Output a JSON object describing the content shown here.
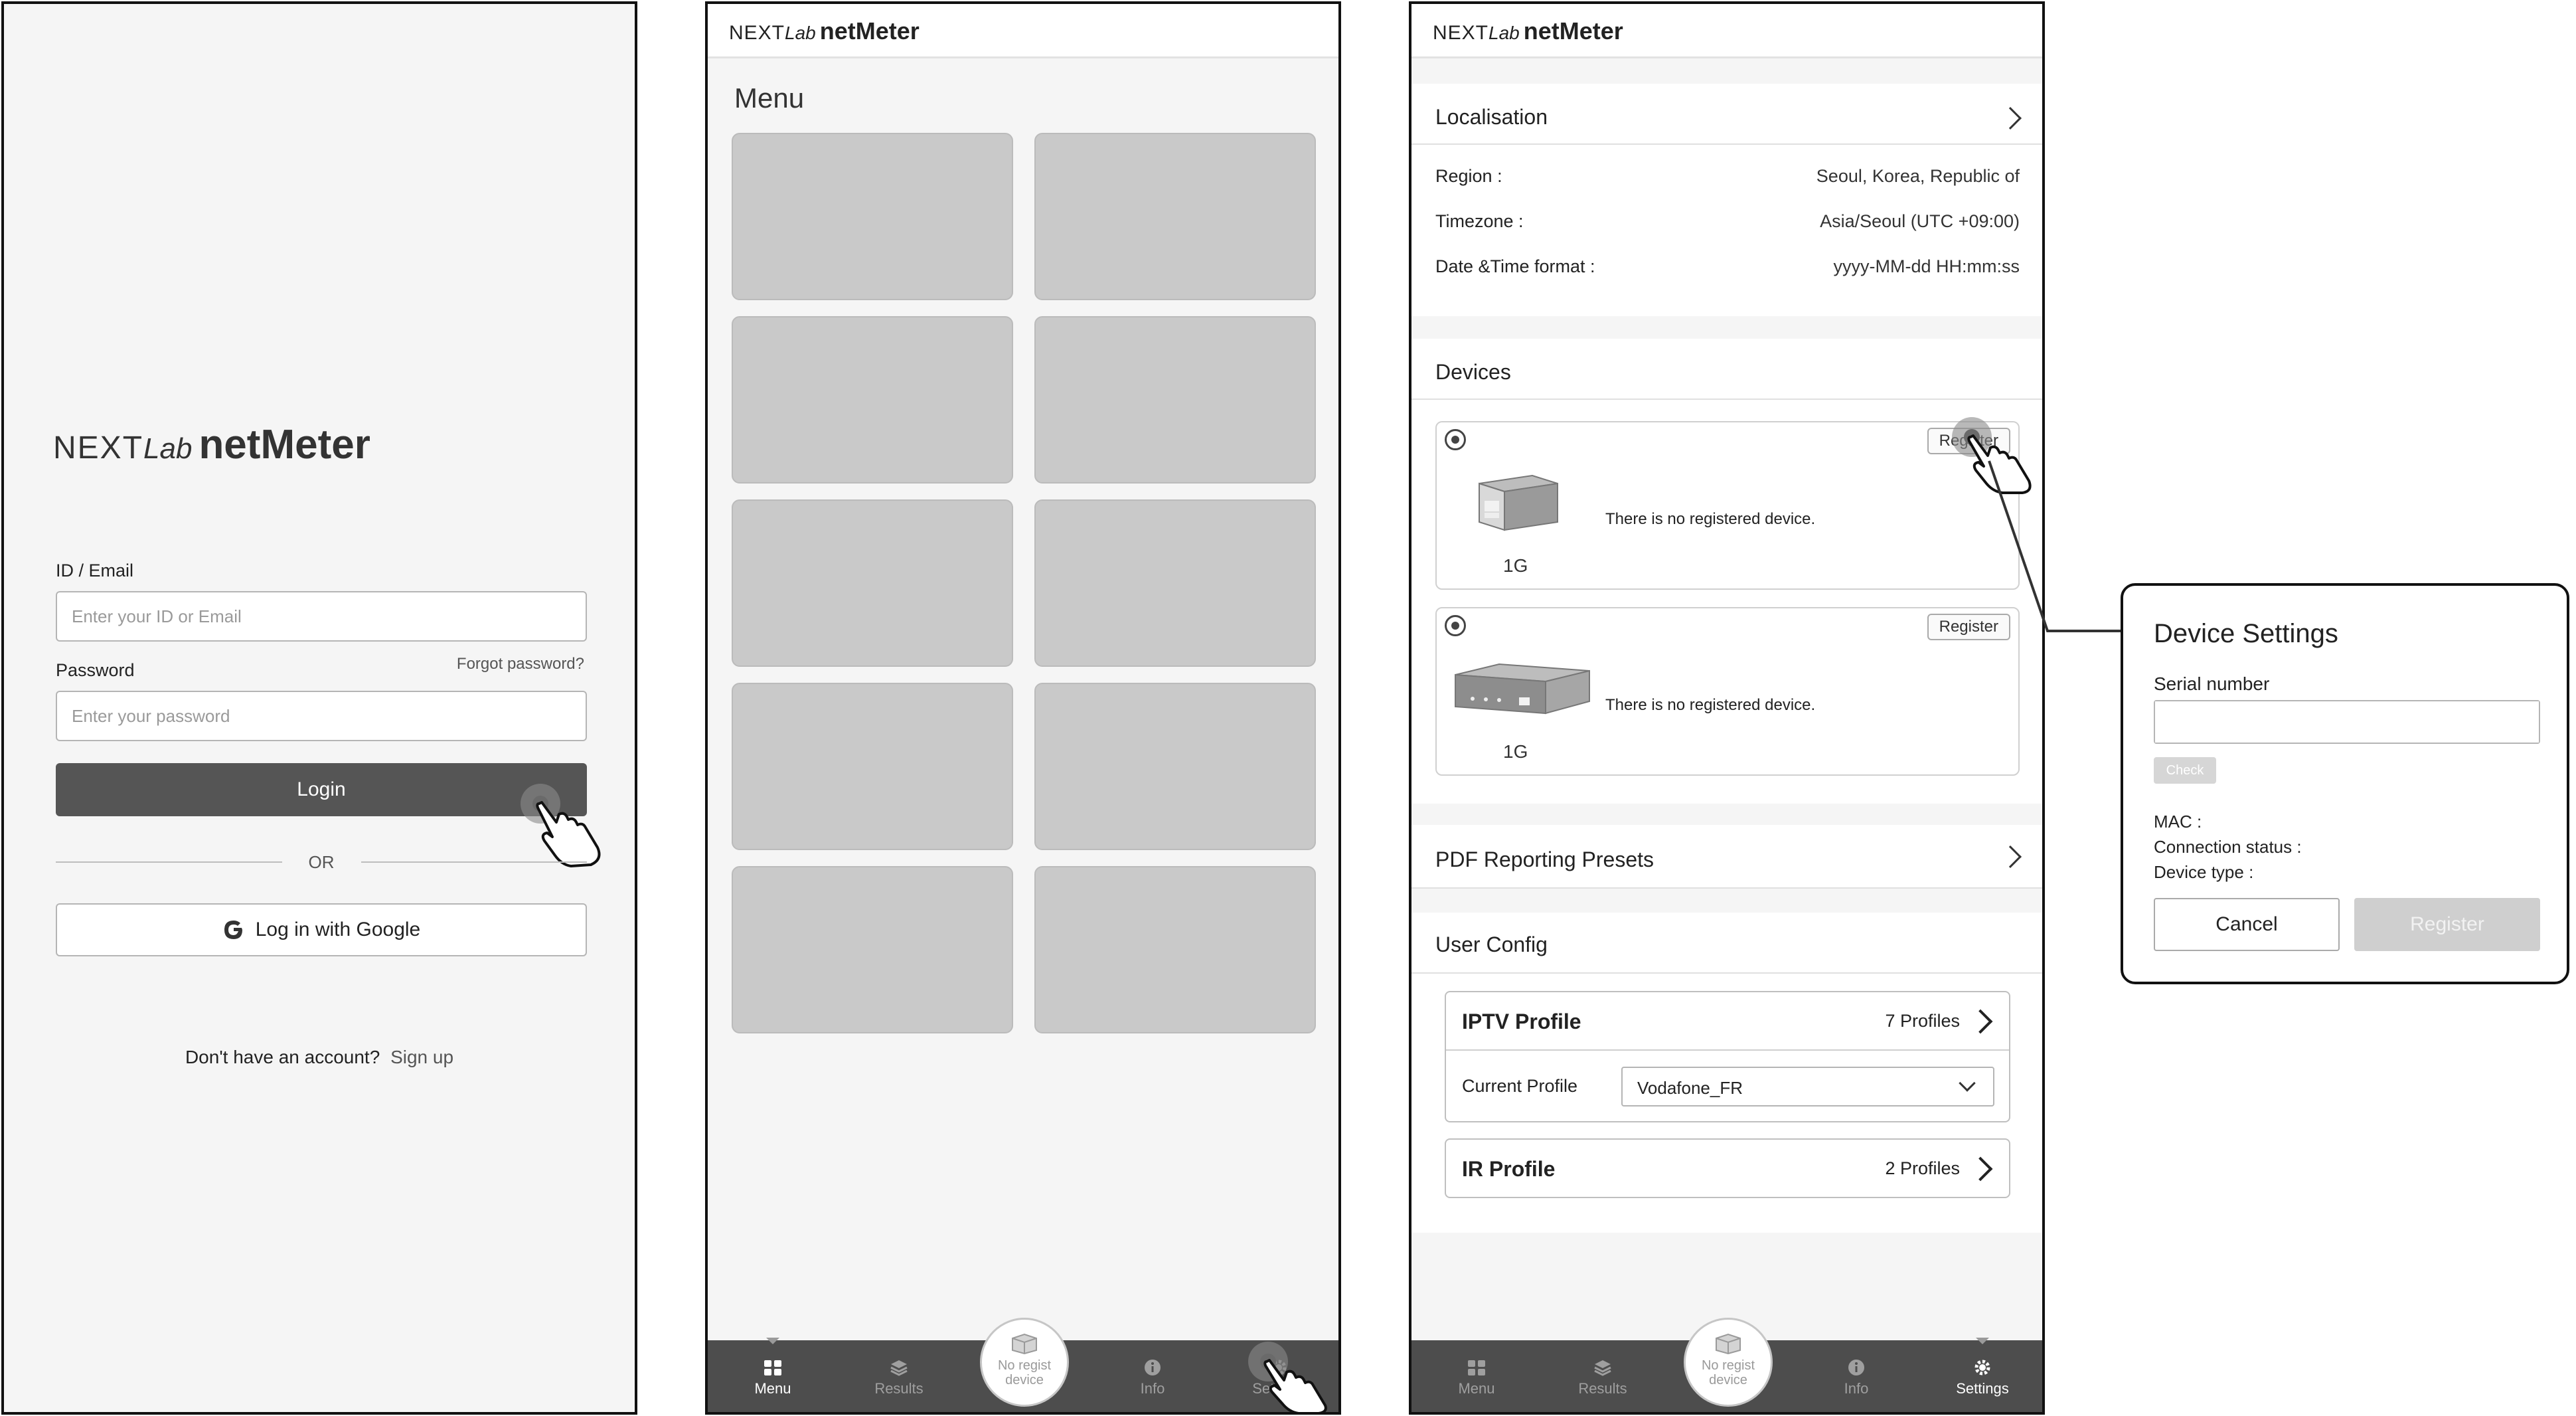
{
  "login": {
    "brand": {
      "next": "NEXT",
      "lab": "Lab",
      "product": "netMeter"
    },
    "id_label": "ID / Email",
    "id_placeholder": "Enter your ID or Email",
    "password_label": "Password",
    "forgot_label": "Forgot password?",
    "password_placeholder": "Enter your password",
    "login_button": "Login",
    "or_label": "OR",
    "google_button": "Log in with Google",
    "no_account_text": "Don't have an account?",
    "signup_link": "Sign up"
  },
  "menu": {
    "brand": {
      "next": "NEXT",
      "lab": "Lab",
      "product": "netMeter"
    },
    "heading": "Menu",
    "tiles": [
      "",
      "",
      "",
      "",
      "",
      "",
      "",
      "",
      "",
      ""
    ]
  },
  "nav": {
    "menu": "Menu",
    "results": "Results",
    "center_line1": "No regist",
    "center_line2": "device",
    "info": "Info",
    "settings": "Settings"
  },
  "settings": {
    "brand": {
      "next": "NEXT",
      "lab": "Lab",
      "product": "netMeter"
    },
    "localisation": {
      "title": "Localisation",
      "region_label": "Region :",
      "region_value": "Seoul, Korea, Republic of",
      "timezone_label": "Timezone :",
      "timezone_value": "Asia/Seoul (UTC +09:00)",
      "datetime_label": "Date &Time format :",
      "datetime_value": "yyyy-MM-dd HH:mm:ss"
    },
    "devices": {
      "title": "Devices",
      "cards": [
        {
          "register_label": "Register",
          "message": "There is no registered device.",
          "speed": "1G"
        },
        {
          "register_label": "Register",
          "message": "There is no registered device.",
          "speed": "1G"
        }
      ]
    },
    "pdf_presets": "PDF Reporting Presets",
    "user_config": {
      "title": "User Config",
      "iptv": {
        "title": "IPTV Profile",
        "count": "7 Profiles",
        "current_label": "Current Profile",
        "current_value": "Vodafone_FR"
      },
      "ir": {
        "title": "IR Profile",
        "count": "2 Profiles"
      }
    }
  },
  "dialog": {
    "title": "Device Settings",
    "serial_label": "Serial number",
    "serial_value": "",
    "check_button": "Check",
    "mac_label": "MAC :",
    "connection_label": "Connection status :",
    "device_type_label": "Device type :",
    "cancel_button": "Cancel",
    "register_button": "Register"
  },
  "colors": {
    "frame": "#111111",
    "screen_bg": "#f5f5f5",
    "primary_button": "#555555",
    "nav_bar": "#4d4d4d",
    "tile": "#c9c9c9",
    "disabled": "#cfcfcf"
  },
  "icons": {
    "nav_menu": "grid-icon",
    "nav_results": "layers-icon",
    "nav_center": "device-box-icon",
    "nav_info": "info-icon",
    "nav_settings": "gear-icon",
    "pointer": "hand-pointer-icon"
  }
}
